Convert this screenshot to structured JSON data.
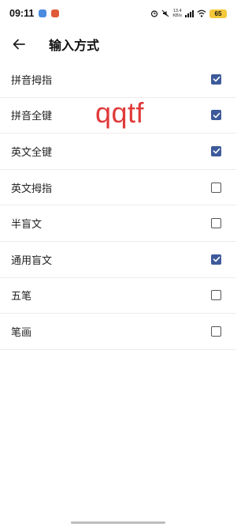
{
  "status_bar": {
    "time": "09:11",
    "net_speed_value": "13.4",
    "net_speed_unit": "KB/s",
    "battery_level": "65"
  },
  "header": {
    "title": "输入方式"
  },
  "overlay_text": "qqtf",
  "options": [
    {
      "label": "拼音拇指",
      "checked": true
    },
    {
      "label": "拼音全键",
      "checked": true
    },
    {
      "label": "英文全键",
      "checked": true
    },
    {
      "label": "英文拇指",
      "checked": false
    },
    {
      "label": "半盲文",
      "checked": false
    },
    {
      "label": "通用盲文",
      "checked": true
    },
    {
      "label": "五笔",
      "checked": false
    },
    {
      "label": "笔画",
      "checked": false
    }
  ],
  "colors": {
    "accent": "#3d5a9a",
    "overlay": "#e03a3a"
  }
}
